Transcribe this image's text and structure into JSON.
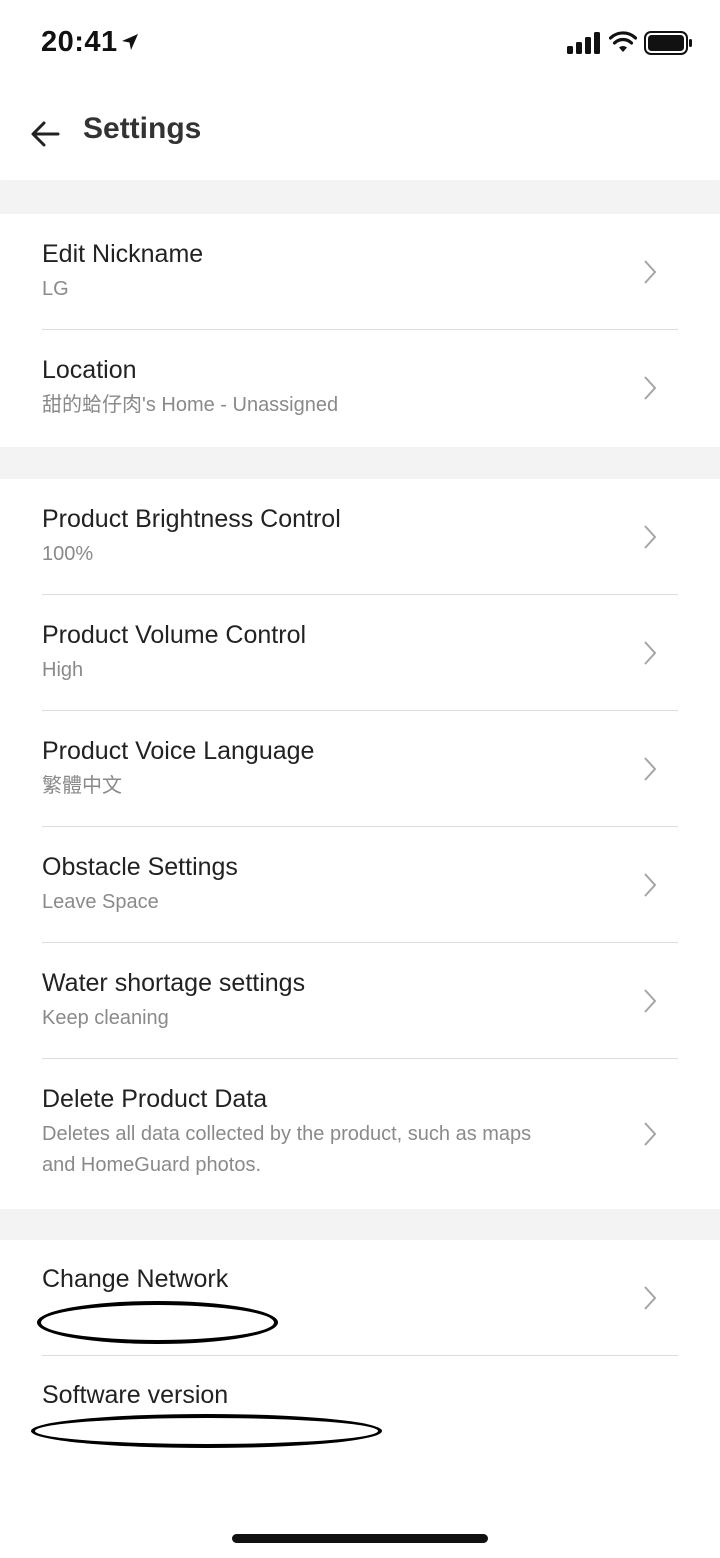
{
  "status_bar": {
    "time": "20:41"
  },
  "header": {
    "title": "Settings"
  },
  "sections": [
    {
      "items": [
        {
          "title": "Edit Nickname",
          "subtitle": "LG"
        },
        {
          "title": "Location",
          "subtitle": "甜的蛤仔肉's Home - Unassigned"
        }
      ]
    },
    {
      "items": [
        {
          "title": "Product Brightness Control",
          "subtitle": "100%"
        },
        {
          "title": "Product Volume Control",
          "subtitle": "High"
        },
        {
          "title": "Product Voice Language",
          "subtitle": "繁體中文"
        },
        {
          "title": "Obstacle Settings",
          "subtitle": "Leave Space"
        },
        {
          "title": "Water shortage settings",
          "subtitle": "Keep cleaning"
        },
        {
          "title": "Delete Product Data",
          "subtitle_line1": "Deletes all data collected by the product, such as maps",
          "subtitle_line2": "and HomeGuard photos."
        }
      ]
    },
    {
      "items": [
        {
          "title": "Change Network"
        },
        {
          "title": "Software version"
        }
      ]
    }
  ]
}
